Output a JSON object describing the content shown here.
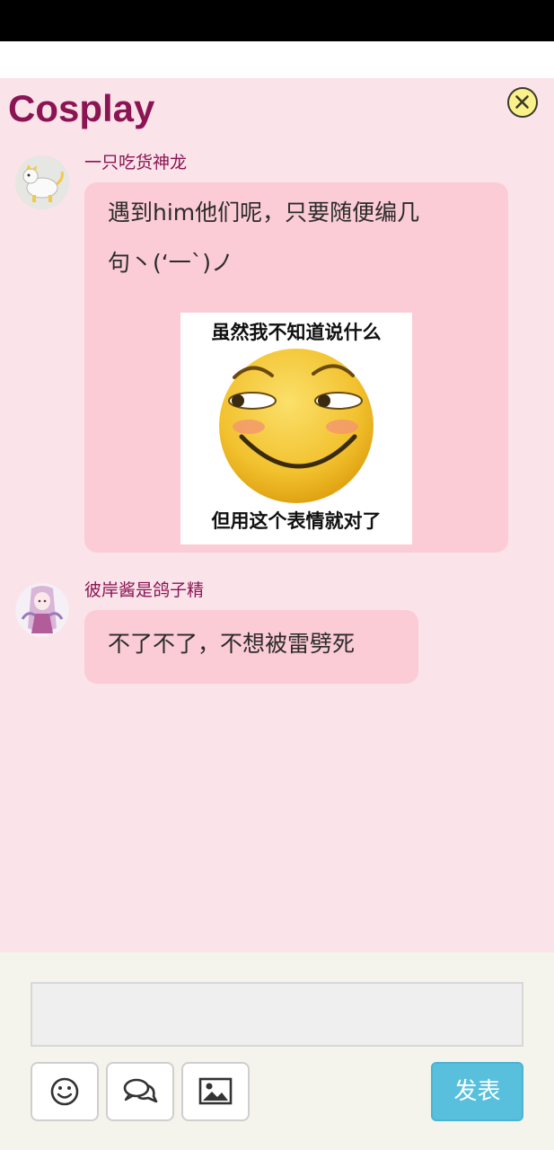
{
  "header": {
    "title": "Cosplay",
    "close_icon": "close-circle-icon"
  },
  "messages": [
    {
      "username": "一只吃货神龙",
      "avatar": "white-creature-avatar",
      "text_line1": "遇到him他们呢，只要随便编几",
      "text_line2": "句丶(‘一`)ノ",
      "meme": {
        "top_text": "虽然我不知道说什么",
        "bottom_text": "但用这个表情就对了",
        "icon": "smirking-face-sticker"
      }
    },
    {
      "username": "彼岸酱是鸽子精",
      "avatar": "anime-girl-avatar",
      "text": "不了不了，不想被雷劈死"
    }
  ],
  "composer": {
    "input_value": "",
    "emoji_icon": "smiley-icon",
    "chat_icon": "speech-bubbles-icon",
    "image_icon": "image-icon",
    "send_label": "发表"
  },
  "colors": {
    "panel_bg": "#fbe3ea",
    "bubble_bg": "#fbcbd6",
    "title": "#8b1453",
    "send_button": "#58c0dd",
    "composer_bg": "#f4f3ec"
  }
}
